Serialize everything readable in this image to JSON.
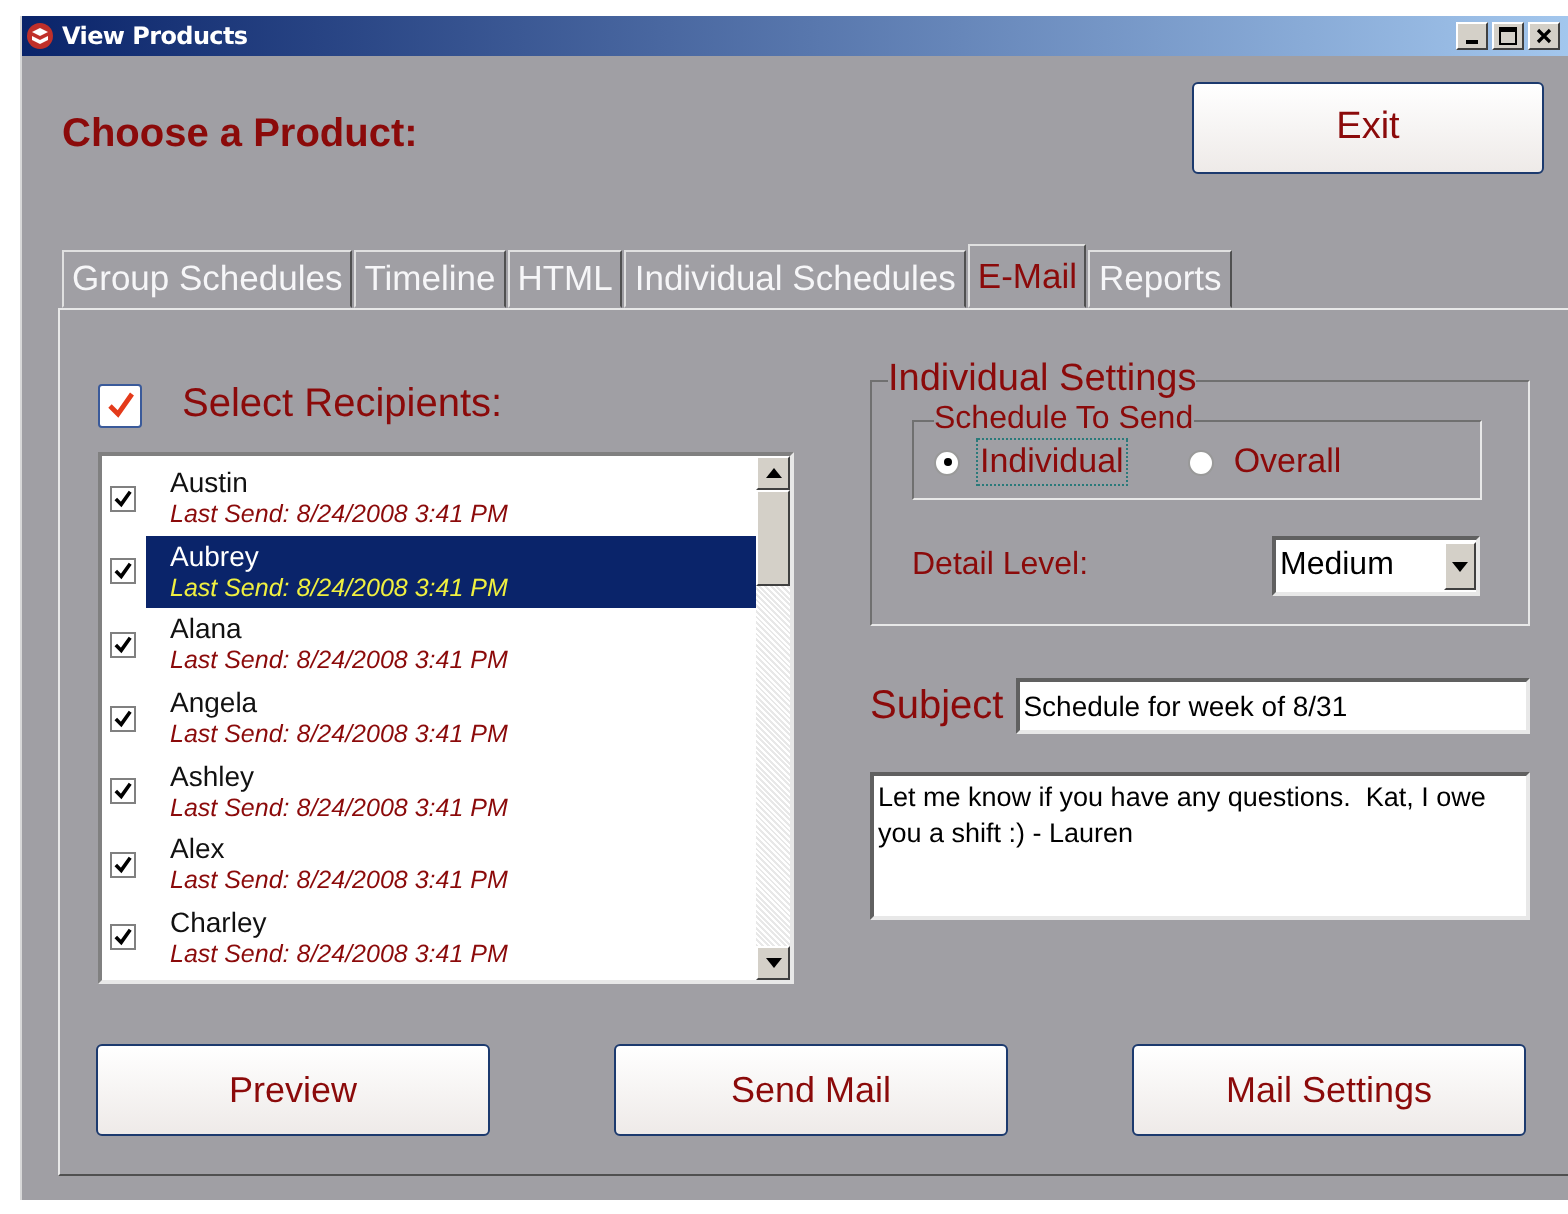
{
  "window": {
    "title": "View Products"
  },
  "heading": "Choose a Product:",
  "exit_button": "Exit",
  "tabs": [
    {
      "label": "Group Schedules",
      "selected": false
    },
    {
      "label": "Timeline",
      "selected": false
    },
    {
      "label": "HTML",
      "selected": false
    },
    {
      "label": "Individual Schedules",
      "selected": false
    },
    {
      "label": "E-Mail",
      "selected": true
    },
    {
      "label": "Reports",
      "selected": false
    }
  ],
  "select_all": {
    "label": "Select Recipients:",
    "checked": true
  },
  "recipients": [
    {
      "name": "Austin",
      "last_send": "Last Send: 8/24/2008 3:41 PM",
      "checked": true,
      "selected": false
    },
    {
      "name": "Aubrey",
      "last_send": "Last Send: 8/24/2008 3:41 PM",
      "checked": true,
      "selected": true
    },
    {
      "name": "Alana",
      "last_send": "Last Send: 8/24/2008 3:41 PM",
      "checked": true,
      "selected": false
    },
    {
      "name": "Angela",
      "last_send": "Last Send: 8/24/2008 3:41 PM",
      "checked": true,
      "selected": false
    },
    {
      "name": "Ashley",
      "last_send": "Last Send: 8/24/2008 3:41 PM",
      "checked": true,
      "selected": false
    },
    {
      "name": "Alex",
      "last_send": "Last Send: 8/24/2008 3:41 PM",
      "checked": true,
      "selected": false
    },
    {
      "name": "Charley",
      "last_send": "Last Send: 8/24/2008 3:41 PM",
      "checked": true,
      "selected": false
    }
  ],
  "individual_settings": {
    "title": "Individual Settings",
    "schedule_group": "Schedule To Send",
    "options": [
      {
        "label": "Individual",
        "selected": true
      },
      {
        "label": "Overall",
        "selected": false
      }
    ],
    "detail_label": "Detail Level:",
    "detail_value": "Medium"
  },
  "subject_label": "Subject",
  "subject_value": "Schedule for week of 8/31",
  "message": "Let me know if you have any questions.  Kat, I owe you a shift :) - Lauren",
  "buttons": [
    "Preview",
    "Send Mail",
    "Mail Settings"
  ]
}
